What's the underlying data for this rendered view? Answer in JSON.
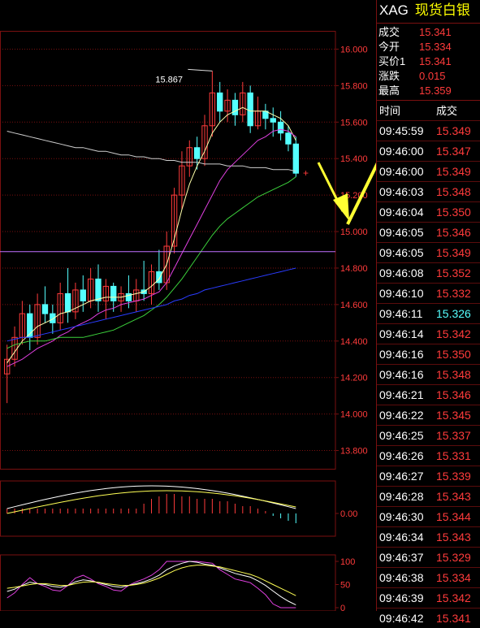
{
  "header": {
    "symbol": "XAG",
    "name": "现货白银"
  },
  "quote": [
    {
      "label": "成交",
      "value": "15.341"
    },
    {
      "label": "今开",
      "value": "15.334"
    },
    {
      "label": "买价1",
      "value": "15.341"
    },
    {
      "label": "涨跌",
      "value": "0.015"
    },
    {
      "label": "最高",
      "value": "15.359"
    }
  ],
  "trades_header": {
    "time": "时间",
    "price": "成交"
  },
  "trades": [
    {
      "time": "09:45:59",
      "price": "15.349",
      "dir": "up"
    },
    {
      "time": "09:46:00",
      "price": "15.347",
      "dir": "up"
    },
    {
      "time": "09:46:00",
      "price": "15.349",
      "dir": "up"
    },
    {
      "time": "09:46:03",
      "price": "15.348",
      "dir": "up"
    },
    {
      "time": "09:46:04",
      "price": "15.350",
      "dir": "up"
    },
    {
      "time": "09:46:05",
      "price": "15.346",
      "dir": "up"
    },
    {
      "time": "09:46:05",
      "price": "15.349",
      "dir": "up"
    },
    {
      "time": "09:46:08",
      "price": "15.352",
      "dir": "up"
    },
    {
      "time": "09:46:10",
      "price": "15.332",
      "dir": "up"
    },
    {
      "time": "09:46:11",
      "price": "15.326",
      "dir": "down"
    },
    {
      "time": "09:46:14",
      "price": "15.342",
      "dir": "up"
    },
    {
      "time": "09:46:16",
      "price": "15.350",
      "dir": "up"
    },
    {
      "time": "09:46:16",
      "price": "15.348",
      "dir": "up"
    },
    {
      "time": "09:46:21",
      "price": "15.346",
      "dir": "up"
    },
    {
      "time": "09:46:22",
      "price": "15.345",
      "dir": "up"
    },
    {
      "time": "09:46:25",
      "price": "15.337",
      "dir": "up"
    },
    {
      "time": "09:46:26",
      "price": "15.331",
      "dir": "up"
    },
    {
      "time": "09:46:27",
      "price": "15.339",
      "dir": "up"
    },
    {
      "time": "09:46:28",
      "price": "15.343",
      "dir": "up"
    },
    {
      "time": "09:46:30",
      "price": "15.344",
      "dir": "up"
    },
    {
      "time": "09:46:34",
      "price": "15.343",
      "dir": "up"
    },
    {
      "time": "09:46:37",
      "price": "15.329",
      "dir": "up"
    },
    {
      "time": "09:46:38",
      "price": "15.334",
      "dir": "up"
    },
    {
      "time": "09:46:39",
      "price": "15.342",
      "dir": "up"
    },
    {
      "time": "09:46:42",
      "price": "15.341",
      "dir": "up"
    }
  ],
  "colors": {
    "up": "#ff3b3b",
    "down": "#54ffff",
    "grid": "#7a1010",
    "axis_text": "#ff3b3b",
    "arrow": "#ffff33"
  },
  "chart_data": {
    "type": "candlestick",
    "price_axis": {
      "ylim": [
        13.7,
        16.1
      ],
      "ticks": [
        "16.000",
        "15.800",
        "15.600",
        "15.400",
        "15.200",
        "15.000",
        "14.800",
        "14.600",
        "14.400",
        "14.200",
        "14.000",
        "13.800"
      ]
    },
    "annotations": {
      "high_label": "15.867"
    },
    "candles": [
      {
        "o": 14.22,
        "h": 14.38,
        "l": 14.06,
        "c": 14.3
      },
      {
        "o": 14.3,
        "h": 14.48,
        "l": 14.26,
        "c": 14.42
      },
      {
        "o": 14.42,
        "h": 14.62,
        "l": 14.38,
        "c": 14.55
      },
      {
        "o": 14.55,
        "h": 14.6,
        "l": 14.35,
        "c": 14.42
      },
      {
        "o": 14.42,
        "h": 14.66,
        "l": 14.38,
        "c": 14.6
      },
      {
        "o": 14.6,
        "h": 14.7,
        "l": 14.5,
        "c": 14.55
      },
      {
        "o": 14.55,
        "h": 14.6,
        "l": 14.44,
        "c": 14.5
      },
      {
        "o": 14.5,
        "h": 14.72,
        "l": 14.46,
        "c": 14.66
      },
      {
        "o": 14.66,
        "h": 14.8,
        "l": 14.5,
        "c": 14.56
      },
      {
        "o": 14.56,
        "h": 14.72,
        "l": 14.52,
        "c": 14.68
      },
      {
        "o": 14.68,
        "h": 14.76,
        "l": 14.56,
        "c": 14.62
      },
      {
        "o": 14.62,
        "h": 14.8,
        "l": 14.58,
        "c": 14.74
      },
      {
        "o": 14.74,
        "h": 14.82,
        "l": 14.56,
        "c": 14.62
      },
      {
        "o": 14.62,
        "h": 14.74,
        "l": 14.52,
        "c": 14.7
      },
      {
        "o": 14.7,
        "h": 14.72,
        "l": 14.56,
        "c": 14.62
      },
      {
        "o": 14.62,
        "h": 14.7,
        "l": 14.56,
        "c": 14.66
      },
      {
        "o": 14.66,
        "h": 14.76,
        "l": 14.58,
        "c": 14.62
      },
      {
        "o": 14.62,
        "h": 14.74,
        "l": 14.56,
        "c": 14.68
      },
      {
        "o": 14.68,
        "h": 14.84,
        "l": 14.62,
        "c": 14.66
      },
      {
        "o": 14.66,
        "h": 14.82,
        "l": 14.6,
        "c": 14.78
      },
      {
        "o": 14.78,
        "h": 14.9,
        "l": 14.68,
        "c": 14.72
      },
      {
        "o": 14.72,
        "h": 15.0,
        "l": 14.68,
        "c": 14.92
      },
      {
        "o": 14.92,
        "h": 15.24,
        "l": 14.88,
        "c": 15.2
      },
      {
        "o": 15.2,
        "h": 15.44,
        "l": 15.12,
        "c": 15.36
      },
      {
        "o": 15.36,
        "h": 15.5,
        "l": 15.3,
        "c": 15.46
      },
      {
        "o": 15.46,
        "h": 15.52,
        "l": 15.34,
        "c": 15.4
      },
      {
        "o": 15.4,
        "h": 15.64,
        "l": 15.36,
        "c": 15.58
      },
      {
        "o": 15.58,
        "h": 15.88,
        "l": 15.52,
        "c": 15.76
      },
      {
        "o": 15.76,
        "h": 15.82,
        "l": 15.6,
        "c": 15.66
      },
      {
        "o": 15.66,
        "h": 15.78,
        "l": 15.6,
        "c": 15.72
      },
      {
        "o": 15.72,
        "h": 15.76,
        "l": 15.58,
        "c": 15.64
      },
      {
        "o": 15.64,
        "h": 15.82,
        "l": 15.6,
        "c": 15.76
      },
      {
        "o": 15.76,
        "h": 15.8,
        "l": 15.54,
        "c": 15.58
      },
      {
        "o": 15.58,
        "h": 15.74,
        "l": 15.56,
        "c": 15.66
      },
      {
        "o": 15.66,
        "h": 15.7,
        "l": 15.56,
        "c": 15.62
      },
      {
        "o": 15.62,
        "h": 15.68,
        "l": 15.52,
        "c": 15.6
      },
      {
        "o": 15.6,
        "h": 15.66,
        "l": 15.5,
        "c": 15.54
      },
      {
        "o": 15.54,
        "h": 15.58,
        "l": 15.44,
        "c": 15.48
      },
      {
        "o": 15.48,
        "h": 15.52,
        "l": 15.3,
        "c": 15.32
      }
    ],
    "moving_averages": [
      {
        "color": "#cfcfcf",
        "values": [
          15.55,
          15.54,
          15.53,
          15.52,
          15.51,
          15.5,
          15.49,
          15.48,
          15.47,
          15.46,
          15.46,
          15.45,
          15.44,
          15.44,
          15.43,
          15.42,
          15.42,
          15.41,
          15.41,
          15.4,
          15.4,
          15.39,
          15.39,
          15.38,
          15.38,
          15.38,
          15.37,
          15.37,
          15.37,
          15.36,
          15.36,
          15.36,
          15.35,
          15.35,
          15.35,
          15.34,
          15.34,
          15.34,
          15.33
        ]
      },
      {
        "color": "#ffffaa",
        "values": [
          14.28,
          14.34,
          14.4,
          14.44,
          14.48,
          14.5,
          14.52,
          14.55,
          14.56,
          14.58,
          14.6,
          14.62,
          14.63,
          14.64,
          14.64,
          14.64,
          14.65,
          14.66,
          14.67,
          14.7,
          14.74,
          14.82,
          14.96,
          15.12,
          15.26,
          15.36,
          15.44,
          15.54,
          15.6,
          15.64,
          15.66,
          15.68,
          15.66,
          15.66,
          15.66,
          15.64,
          15.62,
          15.58,
          15.5
        ]
      },
      {
        "color": "#e040e0",
        "values": [
          14.26,
          14.28,
          14.3,
          14.33,
          14.36,
          14.38,
          14.4,
          14.43,
          14.45,
          14.48,
          14.5,
          14.52,
          14.55,
          14.57,
          14.58,
          14.6,
          14.61,
          14.62,
          14.63,
          14.65,
          14.67,
          14.72,
          14.8,
          14.88,
          14.96,
          15.04,
          15.12,
          15.2,
          15.28,
          15.34,
          15.38,
          15.42,
          15.46,
          15.5,
          15.52,
          15.55,
          15.56,
          15.55,
          15.52
        ]
      },
      {
        "color": "#3cd23c",
        "values": [
          14.36,
          14.38,
          14.39,
          14.4,
          14.4,
          14.4,
          14.41,
          14.42,
          14.42,
          14.42,
          14.42,
          14.43,
          14.44,
          14.45,
          14.46,
          14.48,
          14.5,
          14.52,
          14.54,
          14.57,
          14.6,
          14.64,
          14.69,
          14.74,
          14.8,
          14.86,
          14.92,
          14.98,
          15.03,
          15.07,
          15.1,
          15.13,
          15.16,
          15.19,
          15.21,
          15.23,
          15.25,
          15.27,
          15.3
        ]
      },
      {
        "color": "#2a3cff",
        "values": [
          14.4,
          14.41,
          14.42,
          14.42,
          14.43,
          14.44,
          14.45,
          14.46,
          14.47,
          14.48,
          14.49,
          14.5,
          14.51,
          14.52,
          14.53,
          14.54,
          14.55,
          14.56,
          14.57,
          14.58,
          14.59,
          14.6,
          14.62,
          14.63,
          14.65,
          14.66,
          14.68,
          14.69,
          14.7,
          14.71,
          14.72,
          14.73,
          14.74,
          14.75,
          14.76,
          14.77,
          14.78,
          14.79,
          14.8
        ]
      }
    ],
    "hline": {
      "value": 14.89,
      "color": "#c070ff"
    },
    "macd": {
      "ylabel": "0.00",
      "bars": [
        0.02,
        0.02,
        0.02,
        0.02,
        0.02,
        0.02,
        0.02,
        0.02,
        0.02,
        0.02,
        0.02,
        0.02,
        0.02,
        0.02,
        0.02,
        0.02,
        0.02,
        0.02,
        0.04,
        0.06,
        0.07,
        0.08,
        0.08,
        0.07,
        0.07,
        0.06,
        0.06,
        0.06,
        0.05,
        0.05,
        0.04,
        0.03,
        0.03,
        0.02,
        0.01,
        -0.01,
        -0.02,
        -0.03,
        -0.04
      ]
    },
    "kdj": {
      "ticks": [
        "100",
        "50",
        "0"
      ]
    }
  }
}
